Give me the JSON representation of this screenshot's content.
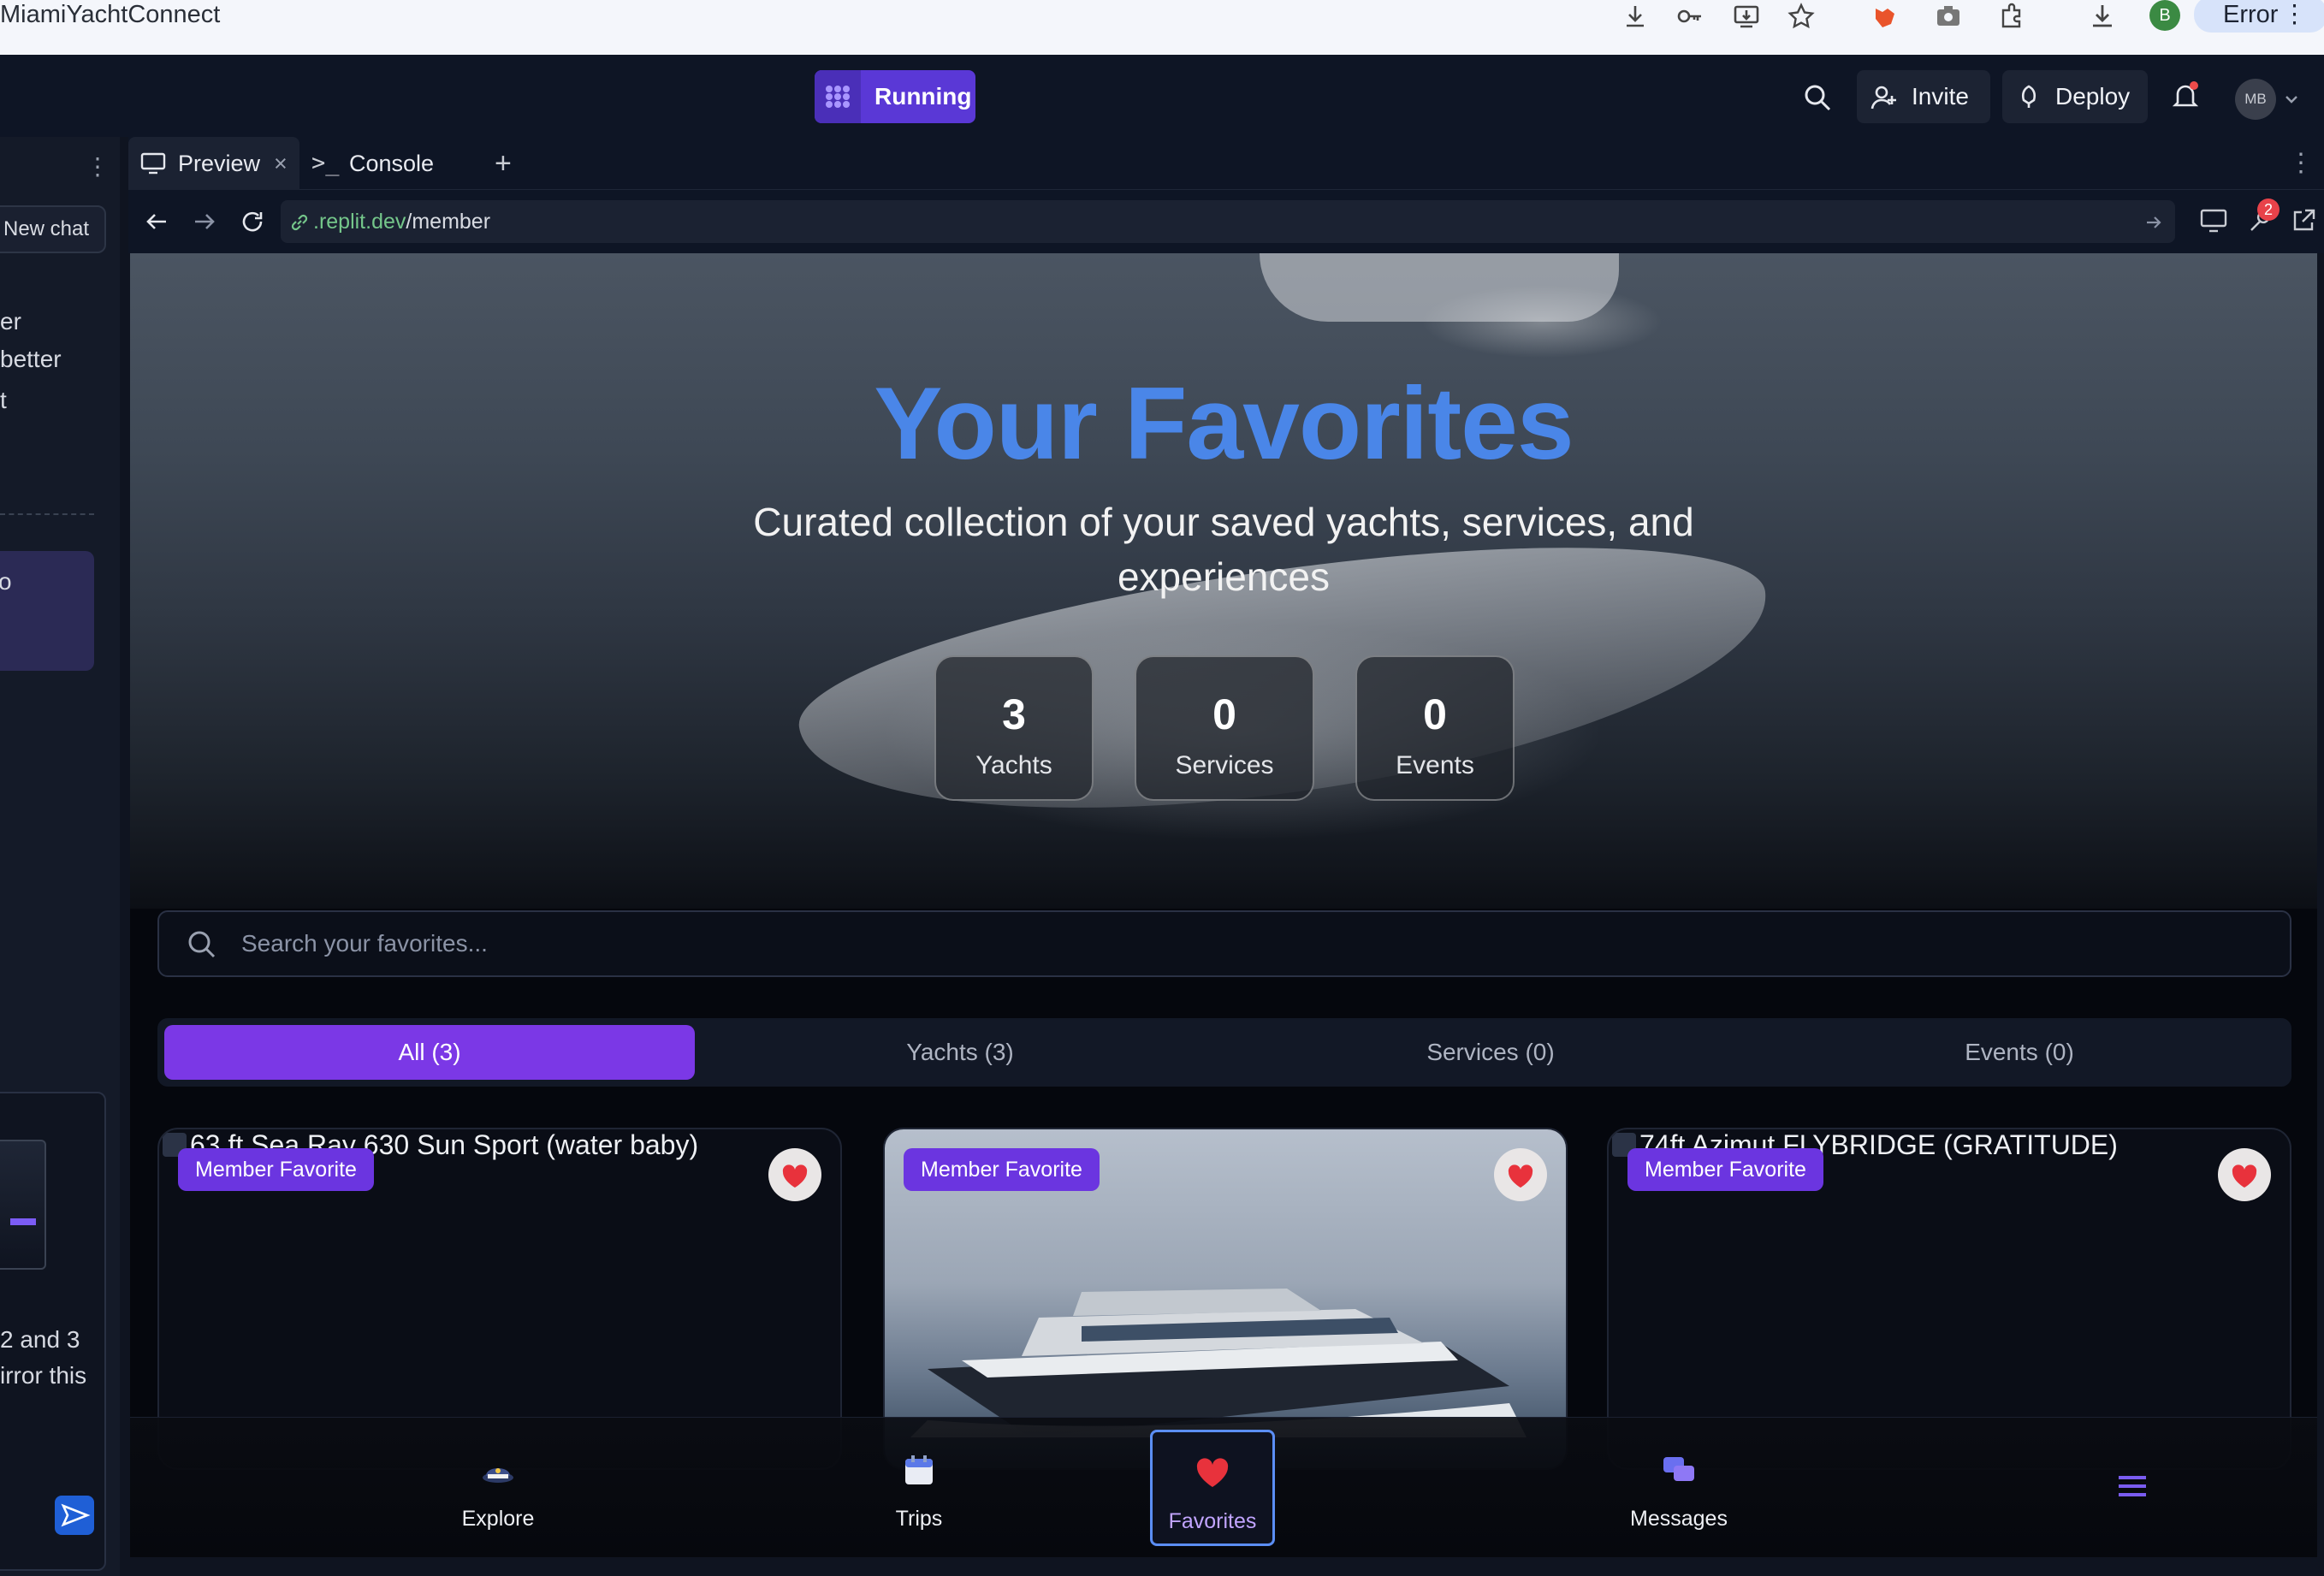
{
  "browser": {
    "tab_title": "MiamiYachtConnect",
    "profile_initial": "B",
    "error_label": "Error"
  },
  "replit": {
    "run_label": "Running",
    "invite_label": "Invite",
    "deploy_label": "Deploy",
    "user_initials": "MB",
    "notifications_dot": true
  },
  "left_panel": {
    "new_chat_label": "New chat",
    "snippets": [
      "er",
      "better",
      "t",
      "o",
      "2 and 3",
      "irror this"
    ]
  },
  "workspace_tabs": [
    {
      "label": "Preview",
      "closable": true
    },
    {
      "label": "Console",
      "closable": false
    }
  ],
  "url": {
    "host": ".replit.dev",
    "path": "/member",
    "tools_badge": "2"
  },
  "page": {
    "hero_title": "Your Favorites",
    "hero_subtitle": "Curated collection of your saved yachts, services, and experiences",
    "stats": [
      {
        "value": "3",
        "label": "Yachts"
      },
      {
        "value": "0",
        "label": "Services"
      },
      {
        "value": "0",
        "label": "Events"
      }
    ],
    "search_placeholder": "Search your favorites...",
    "filters": [
      {
        "label": "All (3)",
        "active": true
      },
      {
        "label": "Yachts (3)",
        "active": false
      },
      {
        "label": "Services (0)",
        "active": false
      },
      {
        "label": "Events (0)",
        "active": false
      }
    ],
    "cards": [
      {
        "alt": "63 ft Sea Ray 630 Sun Sport (water baby)",
        "badge": "Member Favorite",
        "image_loaded": false
      },
      {
        "alt": "",
        "badge": "Member Favorite",
        "image_loaded": true
      },
      {
        "alt": "74ft Azimut FLYBRIDGE (GRATITUDE)",
        "badge": "Member Favorite",
        "image_loaded": false
      }
    ],
    "bottom_nav": [
      {
        "label": "Explore",
        "icon": "captain-hat-icon",
        "active": false
      },
      {
        "label": "Trips",
        "icon": "calendar-icon",
        "active": false
      },
      {
        "label": "Favorites",
        "icon": "heart-icon",
        "active": true
      },
      {
        "label": "Messages",
        "icon": "chat-bubbles-icon",
        "active": false
      },
      {
        "label": "",
        "icon": "hamburger-menu-icon",
        "active": false
      }
    ]
  },
  "colors": {
    "accent_purple": "#7b38e6",
    "hero_title_blue": "#4a86e8",
    "heart_red": "#e8323c",
    "url_host_green": "#74c68a"
  }
}
